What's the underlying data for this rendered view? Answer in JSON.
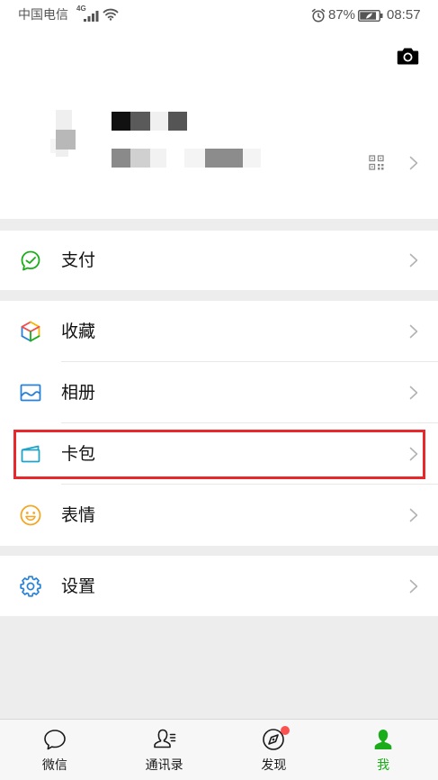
{
  "status_bar": {
    "carrier": "中国电信",
    "network_type": "4G",
    "battery": "87%",
    "time": "08:57",
    "signal_icon": "signal-icon",
    "wifi_icon": "wifi-icon",
    "alarm_icon": "alarm-icon",
    "battery_icon": "battery-icon"
  },
  "header": {
    "camera_icon": "camera-icon",
    "qr_icon": "qr-code-icon",
    "chevron_icon": "chevron-right-icon"
  },
  "menu_groups": [
    [
      {
        "label": "支付",
        "icon": "wechat-pay-icon"
      }
    ],
    [
      {
        "label": "收藏",
        "icon": "favorites-icon"
      },
      {
        "label": "相册",
        "icon": "album-icon"
      },
      {
        "label": "卡包",
        "icon": "card-package-icon",
        "highlighted": true
      },
      {
        "label": "表情",
        "icon": "stickers-icon"
      }
    ],
    [
      {
        "label": "设置",
        "icon": "settings-icon"
      }
    ]
  ],
  "tabs": [
    {
      "label": "微信",
      "icon": "chats-icon",
      "active": false,
      "badge_dot": false
    },
    {
      "label": "通讯录",
      "icon": "contacts-icon",
      "active": false,
      "badge_dot": false
    },
    {
      "label": "发现",
      "icon": "discover-icon",
      "active": false,
      "badge_dot": true
    },
    {
      "label": "我",
      "icon": "me-icon",
      "active": true,
      "badge_dot": false
    }
  ],
  "colors": {
    "accent": "#1AAD19",
    "page_background": "#EDEDED",
    "highlight_border": "#E8282B",
    "badge": "#FA5151",
    "pay_icon": "#1AAD19",
    "album_icon": "#2782D7",
    "card_icon": "#1FA3C7",
    "stickers_icon": "#F5A623",
    "settings_icon": "#2782D7"
  }
}
